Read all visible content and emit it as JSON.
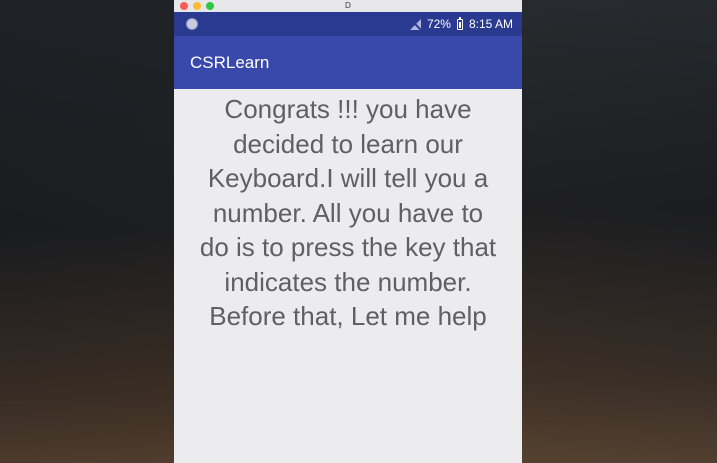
{
  "window": {
    "title": "D"
  },
  "status_bar": {
    "battery_percent": "72%",
    "time": "8:15 AM",
    "icons": [
      "notification-dot-icon",
      "no-sim-icon",
      "battery-icon"
    ]
  },
  "app_bar": {
    "title": "CSRLearn"
  },
  "main": {
    "message": "Congrats !!! you have\ndecided to learn our\nKeyboard.I will tell you a\nnumber. All you have to\ndo is to press the key that\nindicates the number.\nBefore that, Let me help"
  },
  "colors": {
    "status_bar": "#2b3a91",
    "app_bar": "#3949ab",
    "content_background": "#ecebee",
    "message_text": "#606060"
  }
}
